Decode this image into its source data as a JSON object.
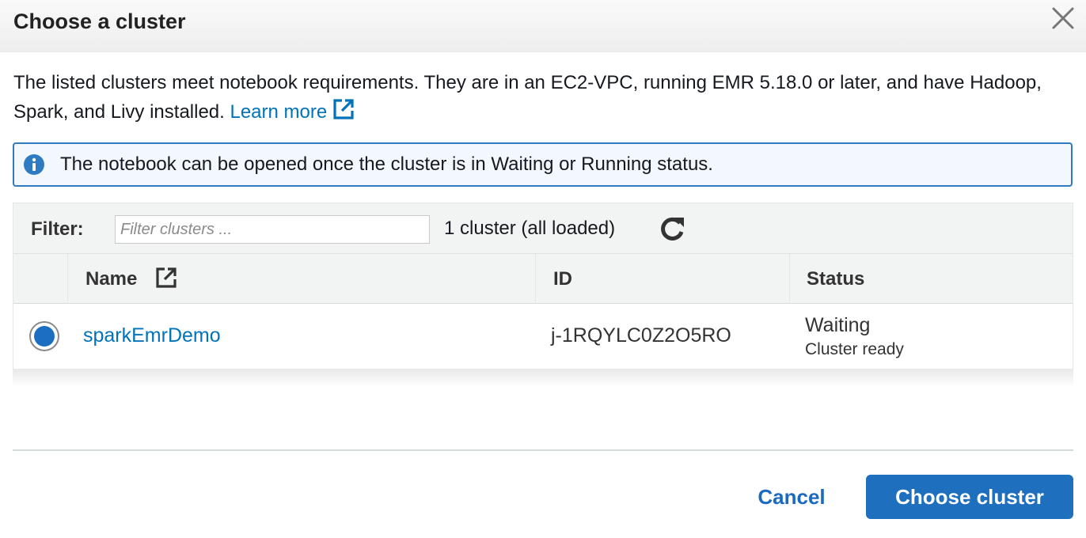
{
  "dialog": {
    "title": "Choose a cluster",
    "close_icon": "close-icon"
  },
  "description": {
    "text": "The listed clusters meet notebook requirements. They are in an EC2-VPC, running EMR 5.18.0 or later, and have Hadoop, Spark, and Livy installed.",
    "link_label": "Learn more",
    "link_icon": "external-link-icon"
  },
  "info": {
    "icon": "info-icon",
    "text": "The notebook can be opened once the cluster is in Waiting or Running status."
  },
  "filter": {
    "label": "Filter:",
    "placeholder": "Filter clusters ...",
    "value": "",
    "count_text": "1 cluster (all loaded)",
    "refresh_icon": "refresh-icon"
  },
  "table": {
    "columns": [
      {
        "label": "Name",
        "icon": "external-link-icon"
      },
      {
        "label": "ID"
      },
      {
        "label": "Status"
      }
    ],
    "rows": [
      {
        "selected": true,
        "name": "sparkEmrDemo",
        "id": "j-1RQYLC0Z2O5RO",
        "status": "Waiting",
        "status_detail": "Cluster ready"
      }
    ]
  },
  "footer": {
    "cancel_label": "Cancel",
    "primary_label": "Choose cluster"
  },
  "colors": {
    "link": "#0073bb",
    "primary_button": "#1f6fbf",
    "info_border": "#2f7bc1",
    "radio_selected": "#1b6ec2"
  }
}
